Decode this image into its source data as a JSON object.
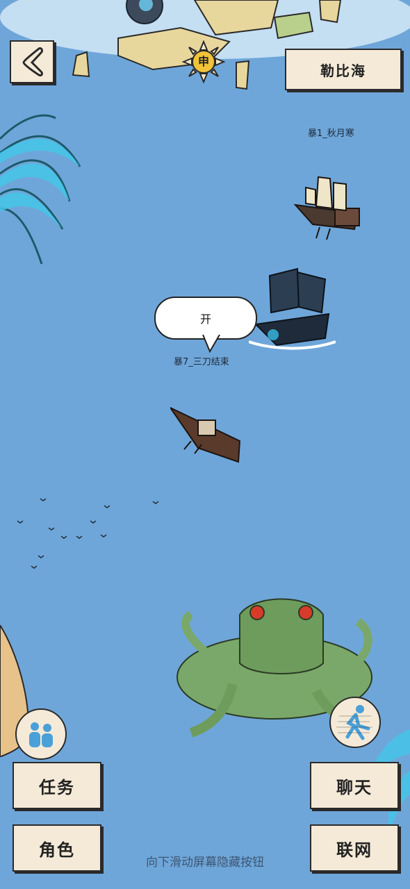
{
  "top": {
    "time_badge": "申"
  },
  "location_button": {
    "label": "勒比海"
  },
  "ships": {
    "ship1_label": "暴1_秋月寒",
    "ship7_label": "暴7_三刀结束"
  },
  "chat_bubble": {
    "text": "开"
  },
  "buttons": {
    "task": "任务",
    "role": "角色",
    "chat": "聊天",
    "network": "联网"
  },
  "hint": "向下滑动屏幕隐藏按钮",
  "colors": {
    "sea": "#6fa6d9",
    "button_bg": "#f5ead8",
    "outline": "#2a2a2a"
  }
}
